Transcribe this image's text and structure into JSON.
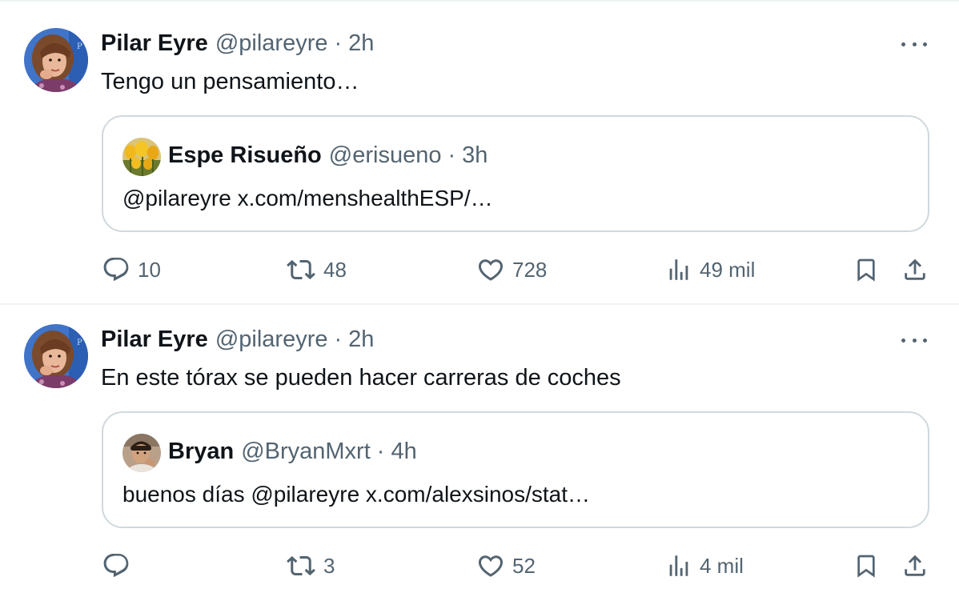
{
  "tweets": [
    {
      "author_name": "Pilar Eyre",
      "handle": "@pilareyre",
      "separator": "·",
      "time": "2h",
      "text": "Tengo un pensamiento…",
      "avatar_icon": "profile-photo-pilar-eyre",
      "more_icon": "more-dots-icon",
      "quote": {
        "author_name": "Espe Risueño",
        "handle": "@erisueno",
        "separator": "·",
        "time": "3h",
        "text": "@pilareyre x.com/menshealthESP/…",
        "avatar_icon": "profile-photo-tulips"
      },
      "actions": {
        "replies": "10",
        "reposts": "48",
        "likes": "728",
        "views": "49 mil"
      }
    },
    {
      "author_name": "Pilar Eyre",
      "handle": "@pilareyre",
      "separator": "·",
      "time": "2h",
      "text": "En este tórax se pueden hacer carreras de coches",
      "avatar_icon": "profile-photo-pilar-eyre",
      "more_icon": "more-dots-icon",
      "quote": {
        "author_name": "Bryan",
        "handle": "@BryanMxrt",
        "separator": "·",
        "time": "4h",
        "text": "buenos días @pilareyre x.com/alexsinos/stat…",
        "avatar_icon": "profile-photo-bryan"
      },
      "actions": {
        "replies": "",
        "reposts": "3",
        "likes": "52",
        "views": "4 mil"
      }
    }
  ],
  "colors": {
    "text_primary": "#0f1419",
    "text_secondary": "#536471",
    "border": "#cfd9de",
    "divider": "#eff3f4"
  },
  "icons": {
    "reply": "reply-icon",
    "repost": "repost-icon",
    "like": "heart-icon",
    "views": "views-chart-icon",
    "bookmark": "bookmark-icon",
    "share": "share-icon"
  }
}
